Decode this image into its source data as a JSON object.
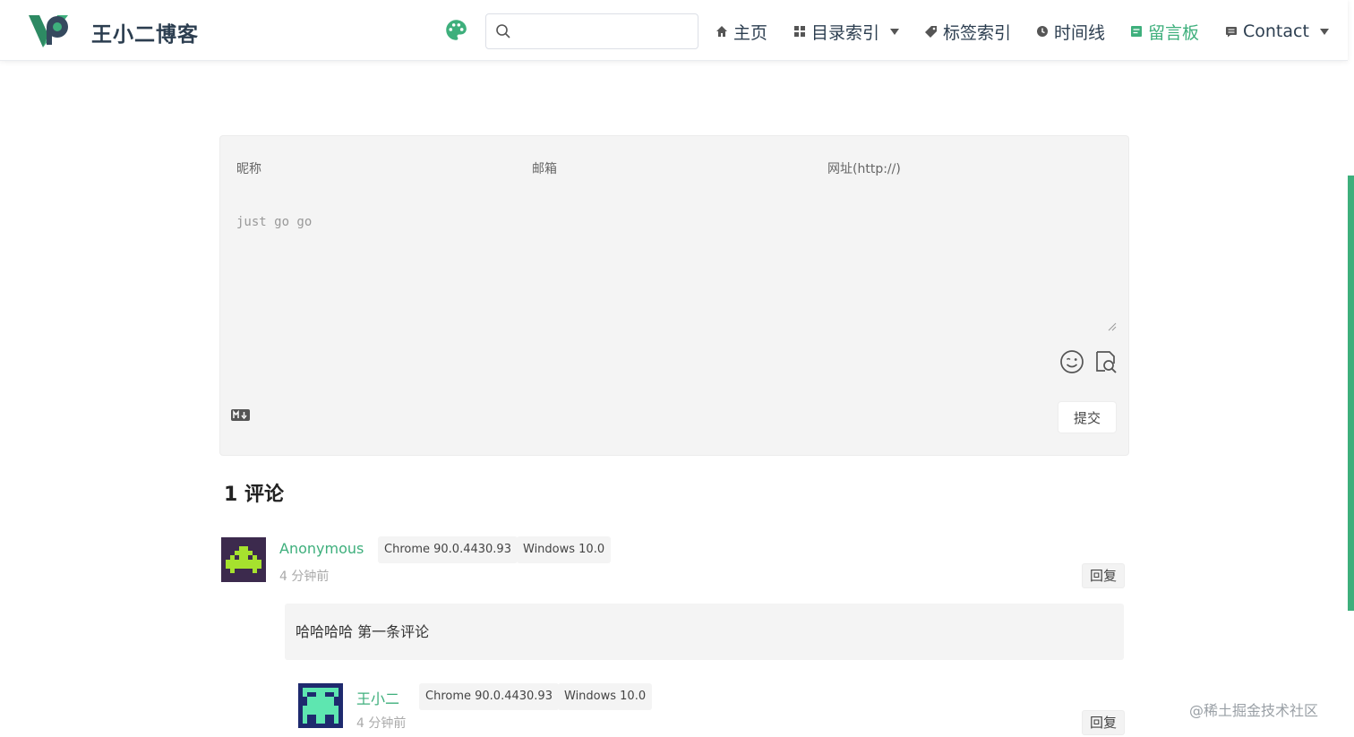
{
  "header": {
    "site_name": "王小二博客",
    "search": {
      "value": "",
      "placeholder": ""
    },
    "nav": [
      {
        "label": "主页",
        "icon": "home-icon"
      },
      {
        "label": "目录索引",
        "icon": "grid-icon",
        "dropdown": true
      },
      {
        "label": "标签索引",
        "icon": "tag-icon"
      },
      {
        "label": "时间线",
        "icon": "clock-icon"
      },
      {
        "label": "留言板",
        "icon": "note-icon",
        "active": true
      },
      {
        "label": "Contact",
        "icon": "message-icon",
        "dropdown": true
      }
    ]
  },
  "form": {
    "nickname_placeholder": "昵称",
    "email_placeholder": "邮箱",
    "url_placeholder": "网址(http://)",
    "editor_placeholder": "just go go",
    "submit_label": "提交"
  },
  "comments": {
    "count_label": "1 评论",
    "items": [
      {
        "author": "Anonymous",
        "browser": "Chrome 90.0.4430.93",
        "os": "Windows 10.0",
        "time": "4 分钟前",
        "reply_label": "回复",
        "body": "哈哈哈哈 第一条评论"
      },
      {
        "author": "王小二",
        "browser": "Chrome 90.0.4430.93",
        "os": "Windows 10.0",
        "time": "4 分钟前",
        "reply_label": "回复"
      }
    ]
  },
  "watermark": "@稀土掘金技术社区",
  "colors": {
    "accent": "#3eaf7c",
    "panel": "#f4f4f4",
    "text": "#2c3e50"
  }
}
